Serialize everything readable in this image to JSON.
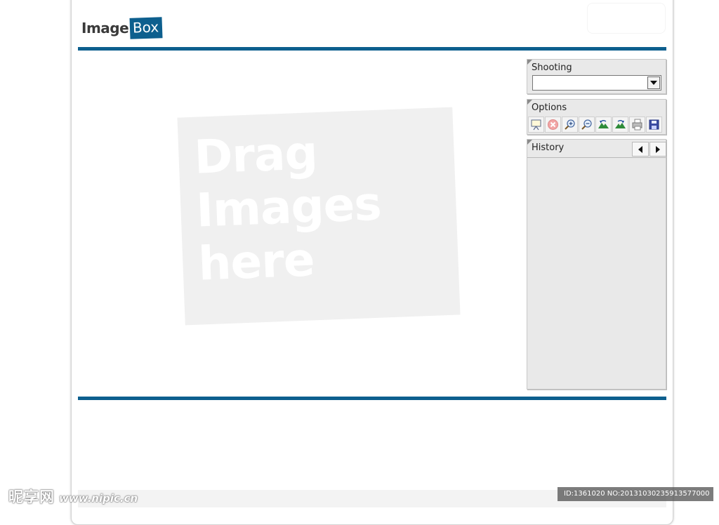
{
  "app": {
    "logo_part1": "Image",
    "logo_part2": "Box",
    "brand_color": "#0d5f8e"
  },
  "drop_zone": {
    "text": "Drag\nImages\nhere"
  },
  "panels": {
    "shooting": {
      "title": "Shooting",
      "selected_value": ""
    },
    "options": {
      "title": "Options",
      "tools": [
        "slideshow-icon",
        "delete-icon",
        "zoom-in-icon",
        "zoom-out-icon",
        "rotate-left-icon",
        "rotate-right-icon",
        "print-icon",
        "save-icon"
      ]
    },
    "history": {
      "title": "History"
    }
  },
  "watermark": {
    "left_cn": "昵享网",
    "left_url": "www.nipic.cn",
    "right": "ID:1361020 NO:20131030235913577000"
  }
}
